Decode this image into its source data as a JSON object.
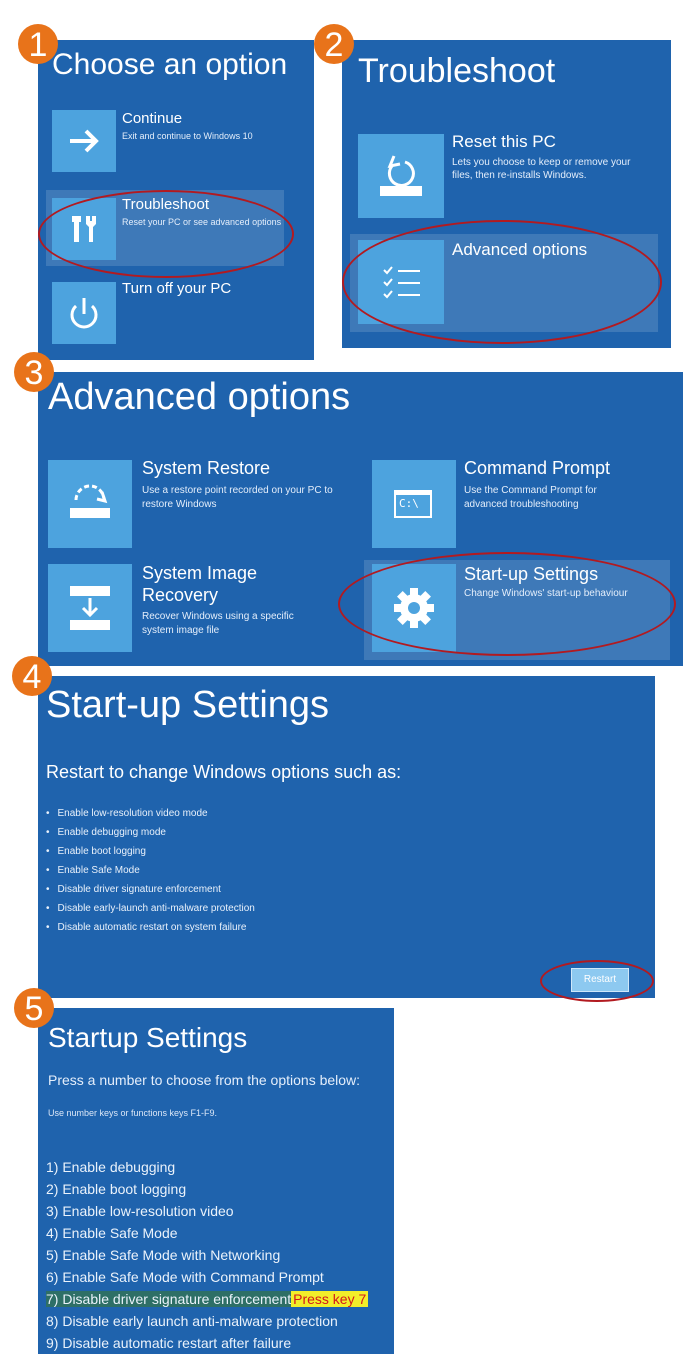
{
  "steps": [
    "1",
    "2",
    "3",
    "4",
    "5"
  ],
  "p1": {
    "title": "Choose an option",
    "continue_title": "Continue",
    "continue_sub": "Exit and continue to Windows 10",
    "troubleshoot_title": "Troubleshoot",
    "troubleshoot_sub": "Reset your PC or see advanced options",
    "turnoff_title": "Turn off your PC"
  },
  "p2": {
    "title": "Troubleshoot",
    "reset_title": "Reset this PC",
    "reset_sub": "Lets you choose to keep or remove your files, then re-installs Windows.",
    "advanced_title": "Advanced options"
  },
  "p3": {
    "title": "Advanced options",
    "restore_title": "System Restore",
    "restore_sub": "Use a restore point recorded on your PC to restore Windows",
    "cmd_title": "Command Prompt",
    "cmd_sub": "Use the Command Prompt for advanced troubleshooting",
    "cmd_icon_text": "C:\\",
    "image_title": "System Image Recovery",
    "image_sub": "Recover Windows using a specific system image file",
    "startup_title": "Start-up Settings",
    "startup_sub": "Change Windows' start-up behaviour"
  },
  "p4": {
    "title": "Start-up Settings",
    "subtitle": "Restart to change Windows options such as:",
    "items": [
      "Enable low-resolution video mode",
      "Enable debugging mode",
      "Enable boot logging",
      "Enable Safe Mode",
      "Disable driver signature enforcement",
      "Disable early-launch anti-malware protection",
      "Disable automatic restart on system failure"
    ],
    "restart_label": "Restart"
  },
  "p5": {
    "title": "Startup Settings",
    "subtitle": "Press a number to choose from the options below:",
    "hint": "Use number keys or functions keys F1-F9.",
    "options": [
      "1) Enable debugging",
      "2) Enable boot logging",
      "3) Enable low-resolution video",
      "4) Enable Safe Mode",
      "5) Enable Safe Mode with Networking",
      "6) Enable Safe Mode with Command Prompt",
      "7) Disable driver signature enforcement",
      "8) Disable early launch anti-malware protection",
      "9) Disable automatic restart after failure"
    ],
    "callout": "Press key 7"
  },
  "colors": {
    "panel": "#1f63ad",
    "tile": "#4da3de",
    "badge": "#e8731a",
    "ring": "#b21a20",
    "callout_bg": "#f2ee2a",
    "callout_text": "#d4171b"
  }
}
